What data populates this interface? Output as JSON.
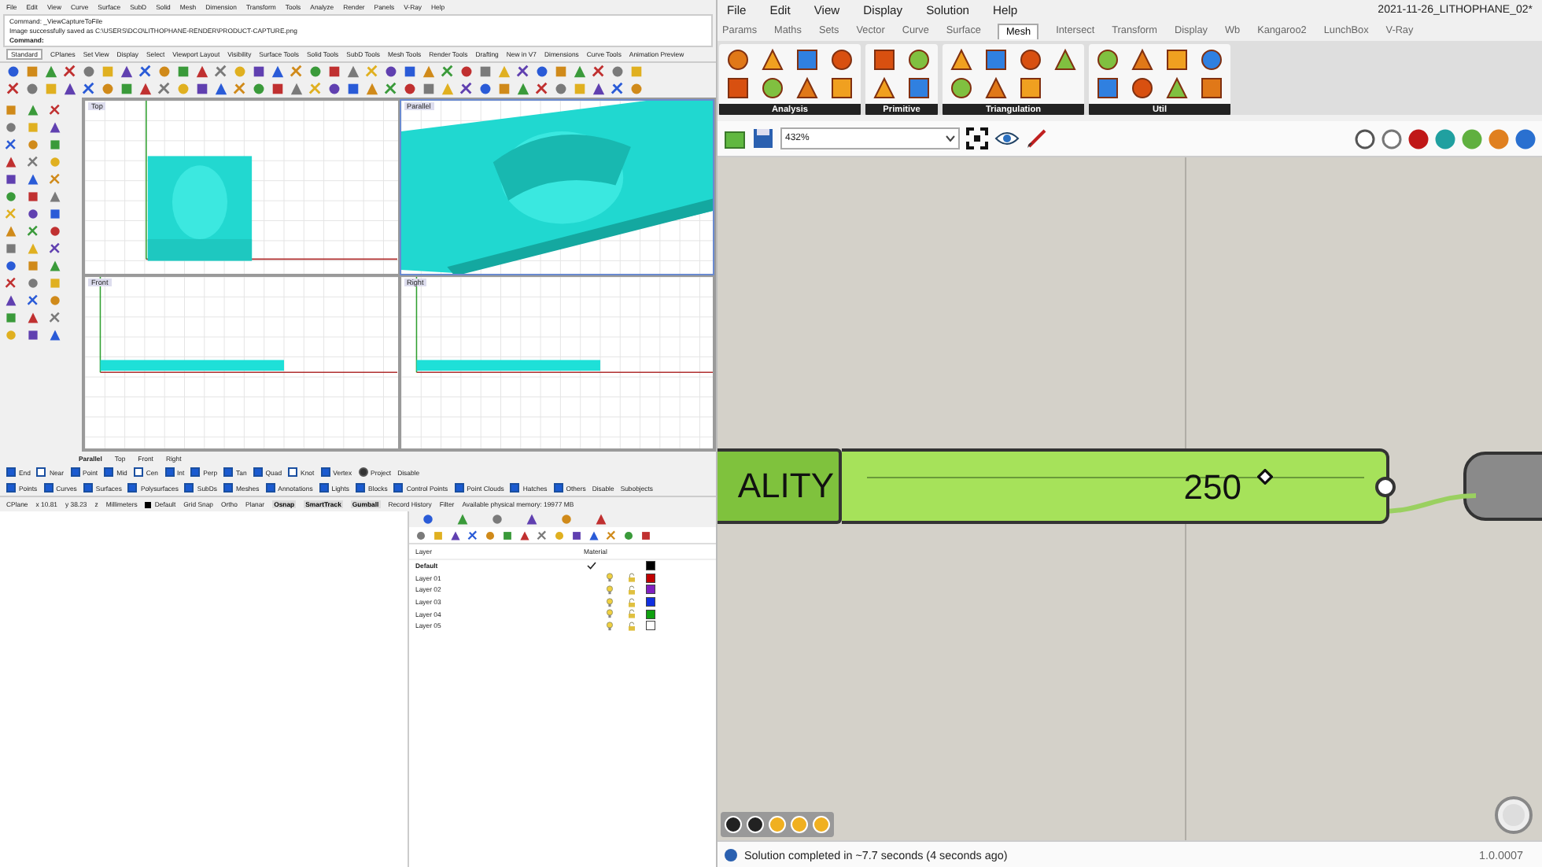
{
  "rhino": {
    "menu": [
      "File",
      "Edit",
      "View",
      "Curve",
      "Surface",
      "SubD",
      "Solid",
      "Mesh",
      "Dimension",
      "Transform",
      "Tools",
      "Analyze",
      "Render",
      "Panels",
      "V-Ray",
      "Help"
    ],
    "command_history": [
      "Command: _ViewCaptureToFile",
      "Image successfully saved as C:\\USERS\\DCO\\LITHOPHANE-RENDER\\PRODUCT-CAPTURE.png"
    ],
    "command_prompt": "Command:",
    "toolbar_tabs": [
      {
        "label": "Standard",
        "selected": true
      },
      {
        "label": "CPlanes",
        "selected": false
      },
      {
        "label": "Set View",
        "selected": false
      },
      {
        "label": "Display",
        "selected": false
      },
      {
        "label": "Select",
        "selected": false
      },
      {
        "label": "Viewport Layout",
        "selected": false
      },
      {
        "label": "Visibility",
        "selected": false
      },
      {
        "label": "Surface Tools",
        "selected": false
      },
      {
        "label": "Solid Tools",
        "selected": false
      },
      {
        "label": "SubD Tools",
        "selected": false
      },
      {
        "label": "Mesh Tools",
        "selected": false
      },
      {
        "label": "Render Tools",
        "selected": false
      },
      {
        "label": "Drafting",
        "selected": false
      },
      {
        "label": "New in V7",
        "selected": false
      },
      {
        "label": "Dimensions",
        "selected": false
      },
      {
        "label": "Curve Tools",
        "selected": false
      },
      {
        "label": "Animation Preview",
        "selected": false
      }
    ],
    "viewports": [
      {
        "title": "Top",
        "kind": "plan",
        "selected": false
      },
      {
        "title": "Parallel",
        "kind": "perspective",
        "selected": true
      },
      {
        "title": "Front",
        "kind": "elevation",
        "selected": false
      },
      {
        "title": "Right",
        "kind": "elevation",
        "selected": false
      }
    ],
    "viewport_tabs": [
      {
        "label": "Parallel",
        "selected": true
      },
      {
        "label": "Top",
        "selected": false
      },
      {
        "label": "Front",
        "selected": false
      },
      {
        "label": "Right",
        "selected": false
      }
    ],
    "osnaps": [
      {
        "label": "End",
        "kind": "checkbox",
        "checked": true
      },
      {
        "label": "Near",
        "kind": "checkbox",
        "checked": false
      },
      {
        "label": "Point",
        "kind": "checkbox",
        "checked": true
      },
      {
        "label": "Mid",
        "kind": "checkbox",
        "checked": true
      },
      {
        "label": "Cen",
        "kind": "checkbox",
        "checked": false
      },
      {
        "label": "Int",
        "kind": "checkbox",
        "checked": true
      },
      {
        "label": "Perp",
        "kind": "checkbox",
        "checked": true
      },
      {
        "label": "Tan",
        "kind": "checkbox",
        "checked": true
      },
      {
        "label": "Quad",
        "kind": "checkbox",
        "checked": true
      },
      {
        "label": "Knot",
        "kind": "checkbox",
        "checked": false
      },
      {
        "label": "Vertex",
        "kind": "checkbox",
        "checked": true
      },
      {
        "label": "Project",
        "kind": "radio",
        "checked": true
      }
    ],
    "osnap_disable": "Disable",
    "filters": [
      {
        "label": "Points",
        "checked": true
      },
      {
        "label": "Curves",
        "checked": true
      },
      {
        "label": "Surfaces",
        "checked": true
      },
      {
        "label": "Polysurfaces",
        "checked": true
      },
      {
        "label": "SubDs",
        "checked": true
      },
      {
        "label": "Meshes",
        "checked": true
      },
      {
        "label": "Annotations",
        "checked": true
      },
      {
        "label": "Lights",
        "checked": true
      },
      {
        "label": "Blocks",
        "checked": true
      },
      {
        "label": "Control Points",
        "checked": true
      },
      {
        "label": "Point Clouds",
        "checked": true
      },
      {
        "label": "Hatches",
        "checked": true
      },
      {
        "label": "Others",
        "checked": true
      }
    ],
    "filter_extras": [
      "Disable",
      "Subobjects"
    ],
    "status": {
      "cplane": "CPlane",
      "x": "x 10.81",
      "y": "y 38.23",
      "z": "z",
      "units": "Millimeters",
      "layer": "Default",
      "toggles": [
        {
          "label": "Grid Snap",
          "on": false
        },
        {
          "label": "Ortho",
          "on": false
        },
        {
          "label": "Planar",
          "on": false
        },
        {
          "label": "Osnap",
          "on": true
        },
        {
          "label": "SmartTrack",
          "on": true
        },
        {
          "label": "Gumball",
          "on": true
        },
        {
          "label": "Record History",
          "on": false
        },
        {
          "label": "Filter",
          "on": false
        }
      ],
      "memory": "Available physical memory: 19977 MB"
    },
    "layers": {
      "header": "Layer",
      "material_header": "Material",
      "rows": [
        {
          "name": "Default",
          "current": true,
          "color": "#000000"
        },
        {
          "name": "Layer 01",
          "current": false,
          "color": "#c00000"
        },
        {
          "name": "Layer 02",
          "current": false,
          "color": "#8020c0"
        },
        {
          "name": "Layer 03",
          "current": false,
          "color": "#1030e0"
        },
        {
          "name": "Layer 04",
          "current": false,
          "color": "#10a010"
        },
        {
          "name": "Layer 05",
          "current": false,
          "color": "#ffffff"
        }
      ]
    }
  },
  "grasshopper": {
    "menu": [
      "File",
      "Edit",
      "View",
      "Display",
      "Solution",
      "Help"
    ],
    "document_title": "2021-11-26_LITHOPHANE_02*",
    "tabs": [
      {
        "label": "Params",
        "selected": false
      },
      {
        "label": "Maths",
        "selected": false
      },
      {
        "label": "Sets",
        "selected": false
      },
      {
        "label": "Vector",
        "selected": false
      },
      {
        "label": "Curve",
        "selected": false
      },
      {
        "label": "Surface",
        "selected": false
      },
      {
        "label": "Mesh",
        "selected": true
      },
      {
        "label": "Intersect",
        "selected": false
      },
      {
        "label": "Transform",
        "selected": false
      },
      {
        "label": "Display",
        "selected": false
      },
      {
        "label": "Wb",
        "selected": false
      },
      {
        "label": "Kangaroo2",
        "selected": false
      },
      {
        "label": "LunchBox",
        "selected": false
      },
      {
        "label": "V-Ray",
        "selected": false
      }
    ],
    "ribbon_groups": [
      "Analysis",
      "Primitive",
      "Triangulation",
      "Util"
    ],
    "zoom": "432%",
    "slider": {
      "label": "ALITY",
      "value": "250",
      "level": 0.8
    },
    "status": "Solution completed in ~7.7 seconds (4 seconds ago)",
    "version": "1.0.0007"
  }
}
